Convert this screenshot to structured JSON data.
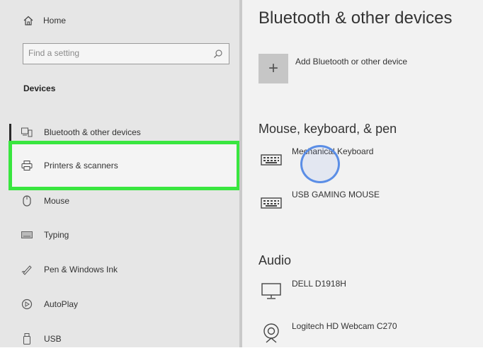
{
  "sidebar": {
    "home_label": "Home",
    "search_placeholder": "Find a setting",
    "section_label": "Devices",
    "items": [
      {
        "label": "Bluetooth & other devices",
        "icon": "bluetooth-devices-icon"
      },
      {
        "label": "Printers & scanners",
        "icon": "printer-icon"
      },
      {
        "label": "Mouse",
        "icon": "mouse-icon"
      },
      {
        "label": "Typing",
        "icon": "keyboard-icon"
      },
      {
        "label": "Pen & Windows Ink",
        "icon": "pen-icon"
      },
      {
        "label": "AutoPlay",
        "icon": "autoplay-icon"
      },
      {
        "label": "USB",
        "icon": "usb-icon"
      }
    ]
  },
  "main": {
    "title": "Bluetooth & other devices",
    "add_button_symbol": "+",
    "add_label": "Add Bluetooth or other device",
    "sections": [
      {
        "heading": "Mouse, keyboard, & pen",
        "devices": [
          "Mechanical Keyboard",
          "USB GAMING MOUSE"
        ]
      },
      {
        "heading": "Audio",
        "devices": [
          "DELL D1918H",
          "Logitech HD Webcam C270"
        ]
      }
    ]
  },
  "colors": {
    "highlight": "#39e63f",
    "cursor_ring": "#5b8ee6"
  }
}
